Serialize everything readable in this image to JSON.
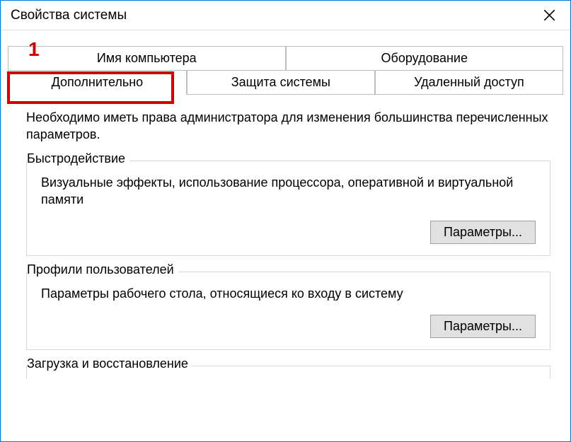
{
  "window": {
    "title": "Свойства системы"
  },
  "annotation": {
    "marker": "1"
  },
  "tabs": {
    "row1": [
      {
        "label": "Имя компьютера"
      },
      {
        "label": "Оборудование"
      }
    ],
    "row2": [
      {
        "label": "Дополнительно",
        "active": true
      },
      {
        "label": "Защита системы"
      },
      {
        "label": "Удаленный доступ"
      }
    ]
  },
  "content": {
    "intro": "Необходимо иметь права администратора для изменения большинства перечисленных параметров.",
    "performance": {
      "title": "Быстродействие",
      "desc": "Визуальные эффекты, использование процессора, оперативной и виртуальной памяти",
      "button": "Параметры..."
    },
    "profiles": {
      "title": "Профили пользователей",
      "desc": "Параметры рабочего стола, относящиеся ко входу в систему",
      "button": "Параметры..."
    },
    "startup": {
      "title": "Загрузка и восстановление"
    }
  }
}
